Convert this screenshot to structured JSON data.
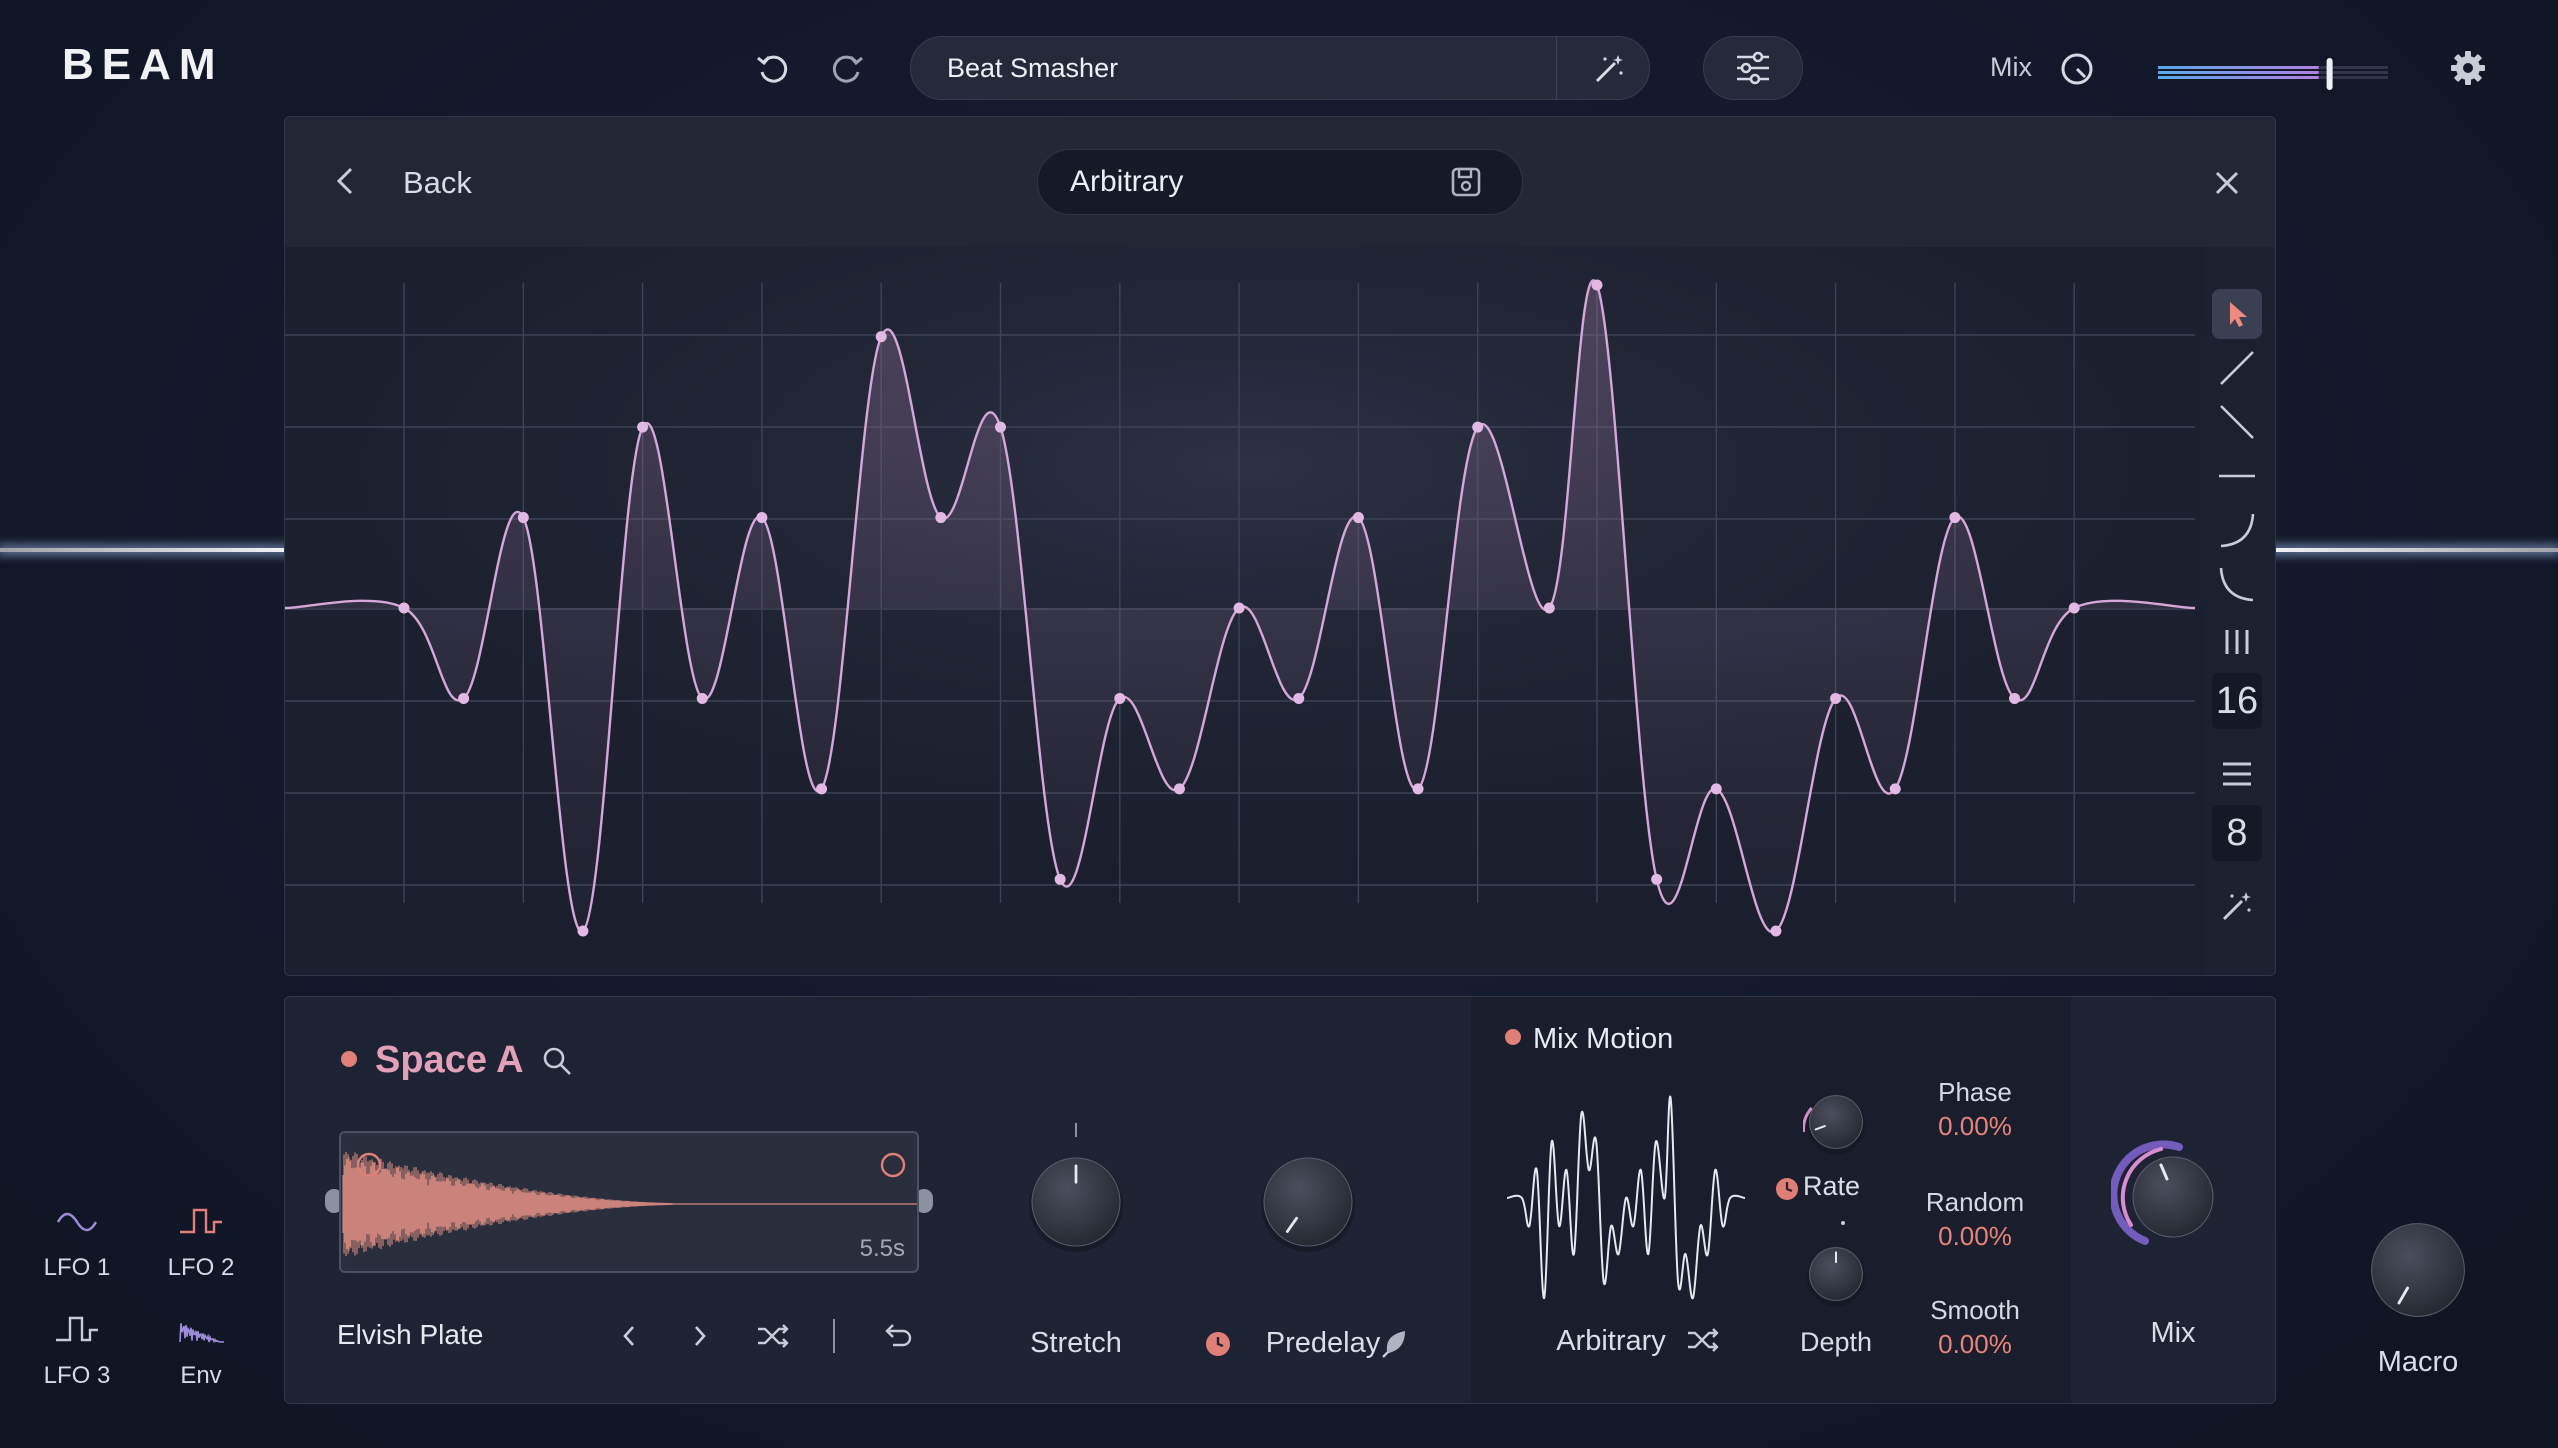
{
  "app": {
    "brand": "BEAM"
  },
  "header": {
    "preset_name": "Beat Smasher",
    "mix_label": "Mix",
    "mix_level": 0.72
  },
  "editor": {
    "back_label": "Back",
    "shape_name": "Arbitrary",
    "grid_x_divisions": 16,
    "grid_y_divisions": 8,
    "tools": [
      "pointer-tool",
      "rise-line-tool",
      "fall-line-tool",
      "flat-line-tool",
      "curve-up-tool",
      "curve-down-tool"
    ],
    "x_grid_label": "16",
    "y_grid_label": "8",
    "points": [
      [
        0.0,
        0.5
      ],
      [
        1.0,
        0.5
      ],
      [
        1.5,
        0.36
      ],
      [
        2.0,
        0.64
      ],
      [
        2.5,
        0.0
      ],
      [
        3.0,
        0.78
      ],
      [
        3.5,
        0.36
      ],
      [
        4.0,
        0.64
      ],
      [
        4.5,
        0.22
      ],
      [
        5.0,
        0.92
      ],
      [
        5.5,
        0.64
      ],
      [
        6.0,
        0.78
      ],
      [
        6.5,
        0.08
      ],
      [
        7.0,
        0.36
      ],
      [
        7.5,
        0.22
      ],
      [
        8.0,
        0.5
      ],
      [
        8.5,
        0.36
      ],
      [
        9.0,
        0.64
      ],
      [
        9.5,
        0.22
      ],
      [
        10.0,
        0.78
      ],
      [
        10.6,
        0.5
      ],
      [
        11.0,
        1.0
      ],
      [
        11.5,
        0.08
      ],
      [
        12.0,
        0.22
      ],
      [
        12.5,
        0.0
      ],
      [
        13.0,
        0.36
      ],
      [
        13.5,
        0.22
      ],
      [
        14.0,
        0.64
      ],
      [
        14.5,
        0.36
      ],
      [
        15.0,
        0.5
      ],
      [
        16.0,
        0.5
      ]
    ]
  },
  "reverb": {
    "title": "Space A",
    "sample_name": "Elvish Plate",
    "sample_length": "5.5s",
    "stretch_label": "Stretch",
    "predelay_label": "Predelay"
  },
  "mix_motion": {
    "title": "Mix Motion",
    "shape_name": "Arbitrary",
    "rate_label": "Rate",
    "depth_label": "Depth",
    "phase_label": "Phase",
    "phase_value": "0.00%",
    "random_label": "Random",
    "random_value": "0.00%",
    "smooth_label": "Smooth",
    "smooth_value": "0.00%",
    "mix_label": "Mix"
  },
  "modulators": {
    "lfo1": "LFO 1",
    "lfo2": "LFO 2",
    "lfo3": "LFO 3",
    "env": "Env"
  },
  "macro": {
    "label": "Macro"
  },
  "colors": {
    "accent_pink": "#d9a0cf",
    "accent_red": "#e07e78",
    "curve": "#d6a6d8"
  }
}
